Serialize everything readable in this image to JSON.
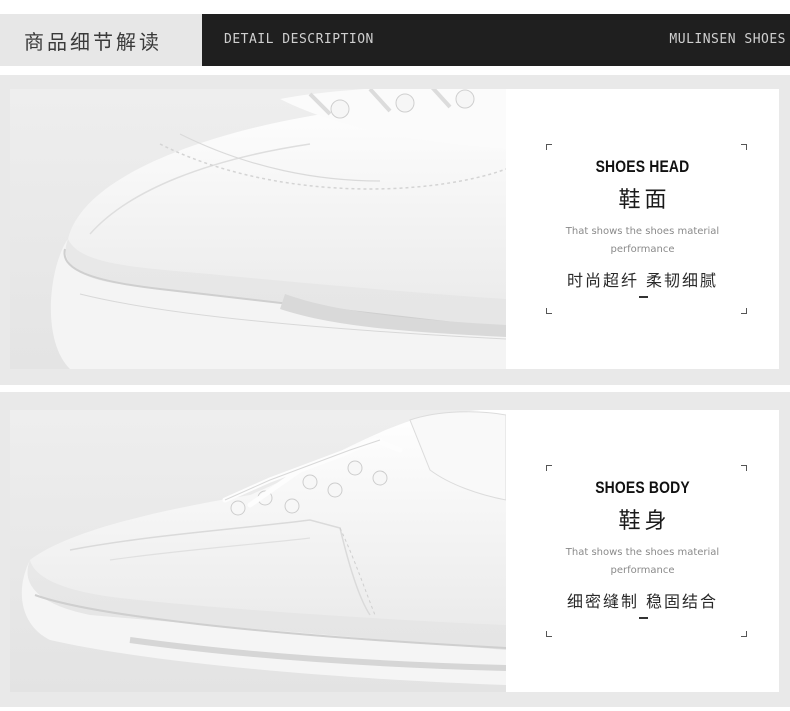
{
  "header": {
    "title_cn": "商品细节解读",
    "description_label": "DETAIL DESCRIPTION",
    "brand": "MULINSEN SHOES"
  },
  "sections": [
    {
      "title": "SHOES HEAD",
      "title_cn": "鞋面",
      "subtitle": "That shows the shoes material performance",
      "description_cn": "时尚超纤 柔韧细腻"
    },
    {
      "title": "SHOES BODY",
      "title_cn": "鞋身",
      "subtitle": "That shows the shoes material performance",
      "description_cn": "细密缝制 稳固结合"
    }
  ],
  "colors": {
    "header_light": "#e7e7e7",
    "header_dark": "#1f1f1f",
    "panel_bg": "#e9e9e9",
    "card_bg": "#ffffff"
  }
}
